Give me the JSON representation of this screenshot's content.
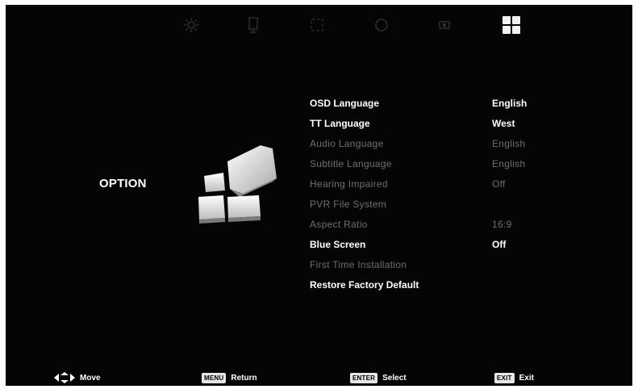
{
  "top_icons": [
    "brightness-icon",
    "speaker-icon",
    "clock-icon",
    "lock-icon",
    "channel-icon",
    "option-grid-icon"
  ],
  "section": {
    "label": "OPTION"
  },
  "menu": [
    {
      "label": "OSD Language",
      "value": "English",
      "state": "active"
    },
    {
      "label": "TT Language",
      "value": "West",
      "state": "selected"
    },
    {
      "label": "Audio Language",
      "value": "English",
      "state": "inactive"
    },
    {
      "label": "Subtitle Language",
      "value": "English",
      "state": "inactive"
    },
    {
      "label": "Hearing Impaired",
      "value": "Off",
      "state": "inactive"
    },
    {
      "label": "PVR File System",
      "value": "",
      "state": "inactive"
    },
    {
      "label": "Aspect Ratio",
      "value": "16:9",
      "state": "inactive"
    },
    {
      "label": "Blue Screen",
      "value": "Off",
      "state": "active"
    },
    {
      "label": "First Time Installation",
      "value": "",
      "state": "inactive"
    },
    {
      "label": "Restore Factory Default",
      "value": "",
      "state": "active"
    }
  ],
  "footer": {
    "move": {
      "label": "Move"
    },
    "menu": {
      "key": "MENU",
      "label": "Return"
    },
    "enter": {
      "key": "ENTER",
      "label": "Select"
    },
    "exit": {
      "key": "EXIT",
      "label": "Exit"
    }
  },
  "colors": {
    "background": "#050505",
    "active_text": "#ffffff",
    "inactive_text": "#6f6f6f"
  }
}
